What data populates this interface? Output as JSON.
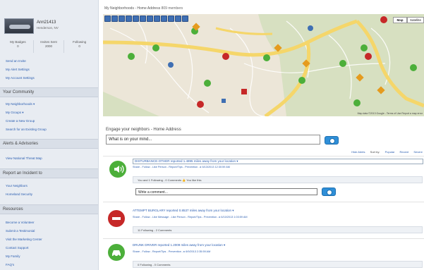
{
  "sidebar": {
    "user": {
      "name": "Ann21413",
      "location": "Henderson, NV"
    },
    "stats": [
      {
        "label": "My Badges",
        "value": "0"
      },
      {
        "label": "Invites Sent",
        "value": "2000"
      },
      {
        "label": "Following",
        "value": "0"
      }
    ],
    "account_links": [
      "Send an Invite",
      "My Alert Settings",
      "My Account Settings"
    ],
    "community": {
      "title": "Your Community",
      "links": [
        "My Neighborhoods ▾",
        "My Groups ▾",
        "Create a New Group",
        "Search for an Existing Group"
      ]
    },
    "alerts": {
      "title": "Alerts & Advisories",
      "links": [
        "View National Threat Map"
      ]
    },
    "report": {
      "title": "Report an Incident to",
      "links": [
        "Your Neighbors",
        "Homeland Security"
      ]
    },
    "resources": {
      "title": "Resources",
      "links": [
        "Become a Volunteer",
        "Submit a Testimonial",
        "Visit the Marketing Center",
        "Contact Support",
        "My Family",
        "FAQ's"
      ]
    }
  },
  "header": {
    "breadcrumb": "My Neighborhoods - Home Address",
    "members": "809 members"
  },
  "map": {
    "map_button": "Map",
    "satellite_button": "Satellite",
    "footer": "Map data ©2013 Google - Terms of Use Report a map error"
  },
  "engage": {
    "title": "Engage your neighbors - Home Address",
    "placeholder": "What is on your mind..."
  },
  "filters": {
    "hide_alerts": "Hide Alerts",
    "sort_by": "Sort by:",
    "options": [
      "Popular",
      "Recent",
      "Severe"
    ]
  },
  "feed": [
    {
      "headline": "DISTURBANCE-OTHER reported 1.4895 miles away from your location  ▾",
      "actions": "Share - Follow - Like Person - Report/Tips - Prevention - ▸ 6/13/2013 12:30:59 AM",
      "summary": "You and 1 Following - 0 Comments  👍 You like this",
      "comment_placeholder": "Write a comment...",
      "color": "#4caf3a"
    },
    {
      "headline": "ATTEMPT BURGLARY reported 0.8537 miles away from your location  ▾",
      "actions": "Share - Follow - Like Message - Like Person - Report/Tips - Prevention - ▸ 6/10/2013 1:03:59 AM",
      "summary": "11 Following - 2 Comments",
      "color": "#c62828"
    },
    {
      "headline": "DRUNK DRIVER reported 1.2009 miles away from your location  ▾",
      "actions": "Share - Follow - Report/Tips - Prevention - ▸ 6/9/2013 2:35:59 AM",
      "summary": "0 Following - 0 Comments",
      "color": "#4caf3a"
    }
  ],
  "colors": {
    "link": "#2a5db0",
    "sidebar_bg": "#e8ecf2",
    "accent_blue": "#2f8fd8"
  }
}
